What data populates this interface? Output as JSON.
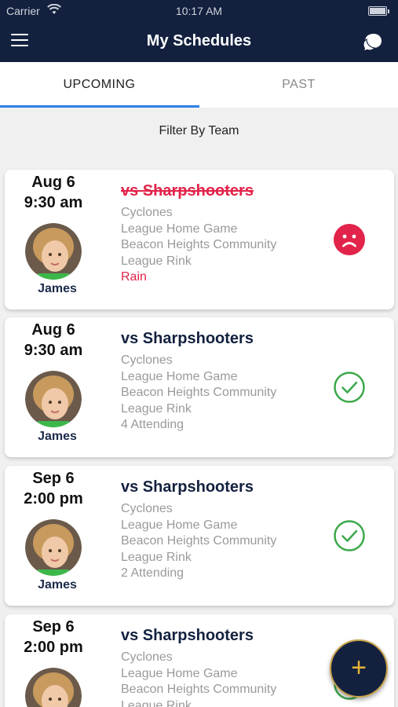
{
  "status_bar": {
    "carrier": "Carrier",
    "time": "10:17 AM"
  },
  "header": {
    "title": "My Schedules",
    "menu_icon": "hamburger-menu-icon",
    "chat_icon": "chat-bubbles-icon"
  },
  "tabs": [
    {
      "label": "UPCOMING",
      "active": true
    },
    {
      "label": "PAST",
      "active": false
    }
  ],
  "filter": {
    "label": "Filter By Team"
  },
  "events": [
    {
      "date": "Aug 6",
      "time": "9:30 am",
      "player": "James",
      "opponent": "vs Sharpshooters",
      "cancelled": true,
      "team": "Cyclones",
      "game_type": "League Home Game",
      "location_line1": "Beacon Heights Community",
      "location_line2": "League Rink",
      "note": "Rain",
      "status_icon": "sad-face-icon"
    },
    {
      "date": "Aug 6",
      "time": "9:30 am",
      "player": "James",
      "opponent": "vs Sharpshooters",
      "cancelled": false,
      "team": "Cyclones",
      "game_type": "League Home Game",
      "location_line1": "Beacon Heights Community",
      "location_line2": "League Rink",
      "note": "4 Attending",
      "status_icon": "check-circle-icon"
    },
    {
      "date": "Sep 6",
      "time": "2:00 pm",
      "player": "James",
      "opponent": "vs Sharpshooters",
      "cancelled": false,
      "team": "Cyclones",
      "game_type": "League Home Game",
      "location_line1": "Beacon Heights Community",
      "location_line2": "League Rink",
      "note": "2 Attending",
      "status_icon": "check-circle-icon"
    },
    {
      "date": "Sep 6",
      "time": "2:00 pm",
      "player": "",
      "opponent": "vs Sharpshooters",
      "cancelled": false,
      "team": "Cyclones",
      "game_type": "League Home Game",
      "location_line1": "Beacon Heights Community",
      "location_line2": "League Rink",
      "note": "",
      "status_icon": "check-circle-icon"
    }
  ],
  "fab": {
    "label": "+",
    "icon": "add-icon"
  },
  "colors": {
    "navy": "#13213f",
    "accent_blue": "#2f80e8",
    "cancel_red": "#e2234a",
    "check_green": "#3ca84a",
    "fab_gold": "#e8b33a"
  }
}
